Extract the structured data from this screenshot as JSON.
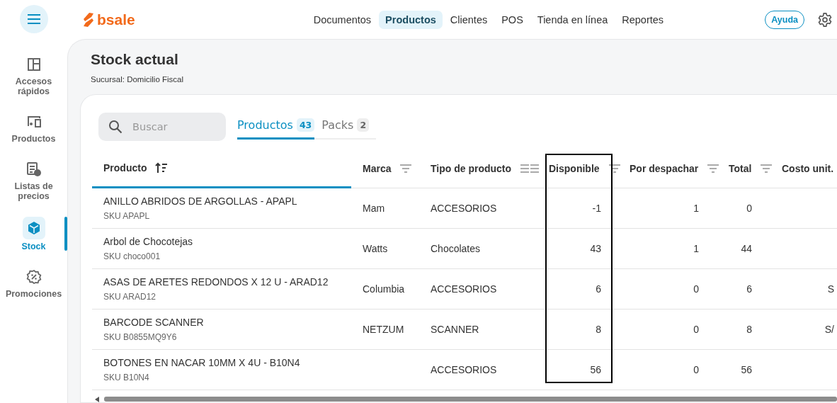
{
  "brand": "bsale",
  "top_nav": {
    "items": [
      {
        "label": "Documentos",
        "selected": false
      },
      {
        "label": "Productos",
        "selected": true
      },
      {
        "label": "Clientes",
        "selected": false
      },
      {
        "label": "POS",
        "selected": false
      },
      {
        "label": "Tienda en línea",
        "selected": false
      },
      {
        "label": "Reportes",
        "selected": false
      }
    ],
    "help_button": "Ayuda"
  },
  "sidebar": {
    "items": [
      {
        "kind": "quick",
        "label": "Accesos rápidos",
        "selected": false
      },
      {
        "kind": "products",
        "label": "Productos",
        "selected": false
      },
      {
        "kind": "prices",
        "label": "Listas de precios",
        "selected": false
      },
      {
        "kind": "stock",
        "label": "Stock",
        "selected": true
      },
      {
        "kind": "promo",
        "label": "Promociones",
        "selected": false
      }
    ]
  },
  "page": {
    "title": "Stock actual",
    "subtitle": "Sucursal: Domicilio Fiscal"
  },
  "search": {
    "placeholder": "Buscar"
  },
  "tabs": [
    {
      "label": "Productos",
      "count": "43",
      "selected": true
    },
    {
      "label": "Packs",
      "count": "2",
      "selected": false
    }
  ],
  "table": {
    "columns": [
      {
        "label": "Producto",
        "kind": "sorted"
      },
      {
        "label": "Marca",
        "kind": "filter"
      },
      {
        "label": "Tipo de producto",
        "kind": "filter2"
      },
      {
        "label": "Disponible",
        "kind": "filter"
      },
      {
        "label": "Por despachar",
        "kind": "filter"
      },
      {
        "label": "Total",
        "kind": "filter"
      },
      {
        "label": "Costo unit.",
        "kind": "none"
      }
    ],
    "rows": [
      {
        "name": "ANILLO ABRIDOS DE ARGOLLAS - APAPL",
        "sku": "SKU APAPL",
        "brand": "Mam",
        "type": "ACCESORIOS",
        "available": "-1",
        "to_ship": "1",
        "total": "0"
      },
      {
        "name": "Arbol de Chocotejas",
        "sku": "SKU choco001",
        "brand": "Watts",
        "type": "Chocolates",
        "available": "43",
        "to_ship": "1",
        "total": "44"
      },
      {
        "name": "ASAS DE ARETES REDONDOS X 12 U - ARAD12",
        "sku": "SKU ARAD12",
        "brand": "Columbia",
        "type": "ACCESORIOS",
        "available": "6",
        "to_ship": "0",
        "total": "6",
        "cost": "S"
      },
      {
        "name": "BARCODE SCANNER",
        "sku": "SKU B0855MQ9Y6",
        "brand": "NETZUM",
        "type": "SCANNER",
        "available": "8",
        "to_ship": "0",
        "total": "8",
        "cost": "S/"
      },
      {
        "name": "BOTONES EN NACAR 10MM X 4U - B10N4",
        "sku": "SKU B10N4",
        "type": "ACCESORIOS",
        "available": "56",
        "to_ship": "0",
        "total": "56"
      }
    ]
  }
}
